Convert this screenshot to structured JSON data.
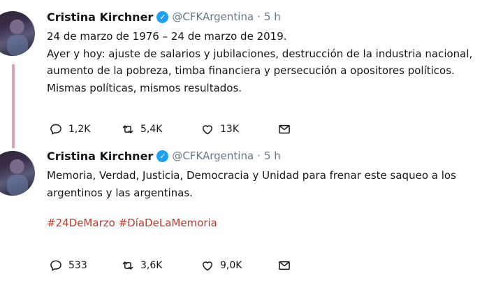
{
  "tweets": [
    {
      "name": "Cristina Kirchner",
      "handle": "@CFKArgentina",
      "separator": "·",
      "time": "5 h",
      "lines": [
        "24 de marzo de 1976 – 24 de marzo de 2019.",
        "Ayer y hoy: ajuste de salarios y jubilaciones, destrucción de la industria nacional,",
        "aumento de la pobreza, timba financiera y persecución a opositores políticos.",
        "Mismas políticas, mismos resultados."
      ],
      "hashtags": [],
      "replies": "1,2K",
      "retweets": "5,4K",
      "likes": "13K"
    },
    {
      "name": "Cristina Kirchner",
      "handle": "@CFKArgentina",
      "separator": "·",
      "time": "5 h",
      "lines": [
        "Memoria, Verdad, Justicia, Democracia y Unidad para frenar este saqueo a los",
        "argentinos y las argentinas."
      ],
      "hashtags": [
        "#24DeMarzo",
        "#DíaDeLaMemoria"
      ],
      "replies": "533",
      "retweets": "3,6K",
      "likes": "9,0K"
    }
  ],
  "colors": {
    "verified": "#1da1f2",
    "hashtag": "#c0392b",
    "thread_line": "#e1a2b0",
    "muted": "#657786"
  },
  "icons": {
    "reply": "reply-icon",
    "retweet": "retweet-icon",
    "like": "like-icon",
    "dm": "message-icon"
  }
}
